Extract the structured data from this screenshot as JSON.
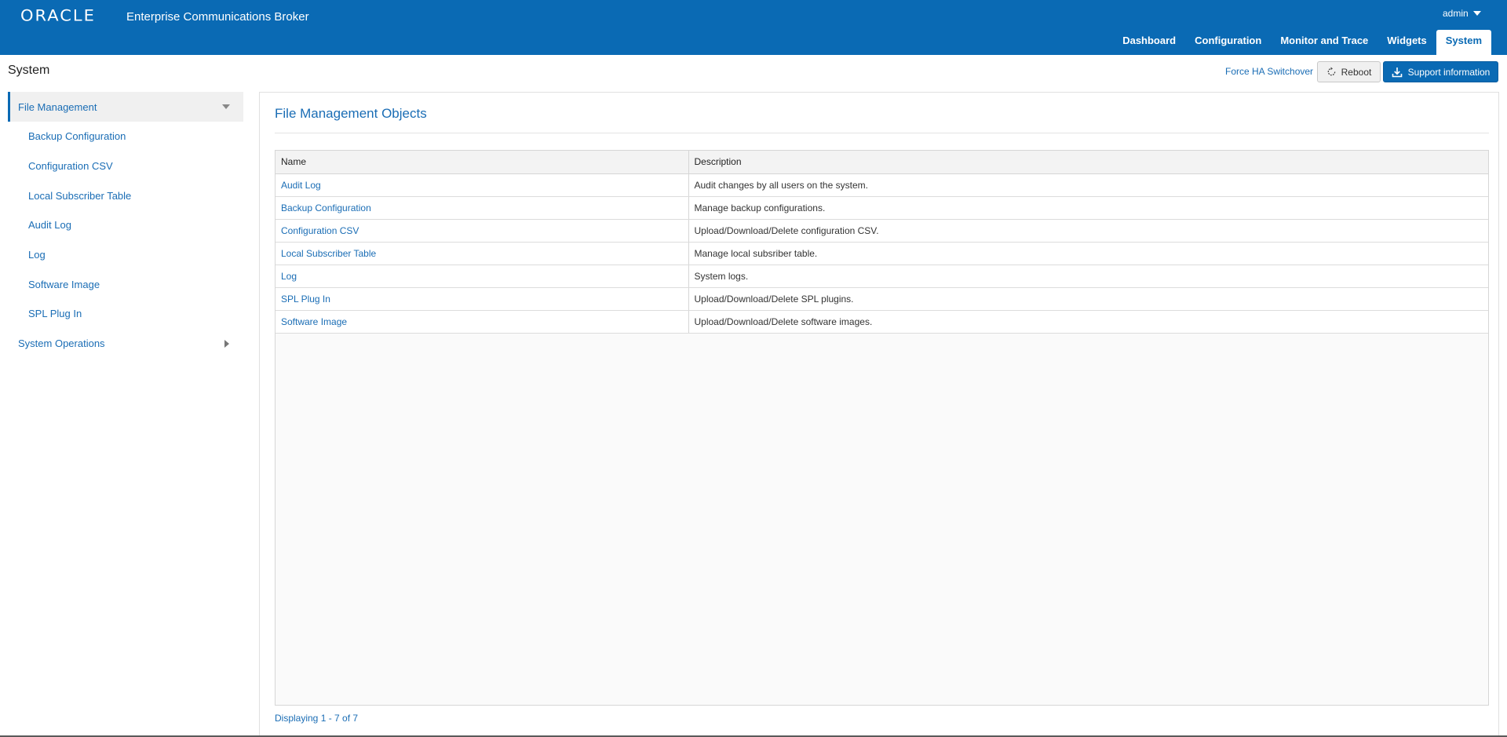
{
  "header": {
    "logo": "ORACLE",
    "app_title": "Enterprise Communications Broker",
    "user": "admin",
    "brand_color": "#0a6ab4",
    "nav_tabs": [
      {
        "label": "Dashboard",
        "active": false
      },
      {
        "label": "Configuration",
        "active": false
      },
      {
        "label": "Monitor and Trace",
        "active": false
      },
      {
        "label": "Widgets",
        "active": false
      },
      {
        "label": "System",
        "active": true
      }
    ]
  },
  "toolbar": {
    "page_title": "System",
    "force_ha_label": "Force HA Switchover",
    "reboot_label": "Reboot",
    "support_label": "Support information"
  },
  "sidebar": {
    "groups": [
      {
        "label": "File Management",
        "expanded": true,
        "items": [
          {
            "label": "Backup Configuration"
          },
          {
            "label": "Configuration CSV"
          },
          {
            "label": "Local Subscriber Table"
          },
          {
            "label": "Audit Log"
          },
          {
            "label": "Log"
          },
          {
            "label": "Software Image"
          },
          {
            "label": "SPL Plug In"
          }
        ]
      },
      {
        "label": "System Operations",
        "expanded": false,
        "items": []
      }
    ]
  },
  "main": {
    "title": "File Management Objects",
    "table": {
      "columns": [
        "Name",
        "Description"
      ],
      "rows": [
        {
          "name": "Audit Log",
          "description": "Audit changes by all users on the system."
        },
        {
          "name": "Backup Configuration",
          "description": "Manage backup configurations."
        },
        {
          "name": "Configuration CSV",
          "description": "Upload/Download/Delete configuration CSV."
        },
        {
          "name": "Local Subscriber Table",
          "description": "Manage local subsriber table."
        },
        {
          "name": "Log",
          "description": "System logs."
        },
        {
          "name": "SPL Plug In",
          "description": "Upload/Download/Delete SPL plugins."
        },
        {
          "name": "Software Image",
          "description": "Upload/Download/Delete software images."
        }
      ]
    },
    "footer_count": "Displaying 1 - 7 of 7"
  }
}
